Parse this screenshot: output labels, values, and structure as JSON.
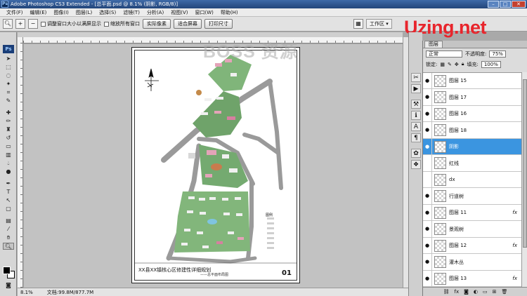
{
  "app": {
    "title": "Adobe Photoshop CS3 Extended - [总平面.psd @ 8.1% (阴影, RGB/8)]",
    "badge": "Ps"
  },
  "menu": [
    "文件(F)",
    "编辑(E)",
    "图像(I)",
    "图层(L)",
    "选择(S)",
    "滤镜(T)",
    "分析(A)",
    "视图(V)",
    "窗口(W)",
    "帮助(H)"
  ],
  "options": {
    "check_resize": "调整窗口大小以满屏显示",
    "check_zoom_all": "缩放所有窗口",
    "btn_actual": "实际像素",
    "btn_fit": "适合屏幕",
    "btn_print": "打印尺寸",
    "workspace": "工作区 ▾"
  },
  "watermark": "BOSS 资源",
  "logo": "Uzing.net",
  "plan": {
    "title": "XX县XX镇核心区修建性详细规划",
    "subtitle": "——总平面布局图",
    "number": "01",
    "legend_title": "图例"
  },
  "status": {
    "zoom": "8.1%",
    "doc": "文档:99.8M/877.7M"
  },
  "layers_panel": {
    "tab": "图层",
    "blend": "正常",
    "opacity_label": "不透明度:",
    "opacity": "75%",
    "lock_label": "锁定:",
    "fill_label": "填充:",
    "fill": "100%",
    "layers": [
      {
        "name": "图层 15",
        "visible": true,
        "fx": false,
        "selected": false
      },
      {
        "name": "图层 17",
        "visible": true,
        "fx": false,
        "selected": false
      },
      {
        "name": "图层 16",
        "visible": true,
        "fx": false,
        "selected": false
      },
      {
        "name": "图层 18",
        "visible": true,
        "fx": false,
        "selected": false
      },
      {
        "name": "阴影",
        "visible": true,
        "fx": false,
        "selected": true
      },
      {
        "name": "红线",
        "visible": false,
        "fx": false,
        "selected": false
      },
      {
        "name": "dx",
        "visible": false,
        "fx": false,
        "selected": false
      },
      {
        "name": "行道树",
        "visible": true,
        "fx": false,
        "selected": false
      },
      {
        "name": "图层 11",
        "visible": true,
        "fx": true,
        "selected": false
      },
      {
        "name": "景观树",
        "visible": true,
        "fx": false,
        "selected": false
      },
      {
        "name": "图层 12",
        "visible": true,
        "fx": true,
        "selected": false
      },
      {
        "name": "灌木丛",
        "visible": true,
        "fx": false,
        "selected": false
      },
      {
        "name": "图层 13",
        "visible": true,
        "fx": true,
        "selected": false
      }
    ],
    "fx_label": "fx",
    "eye_glyph": "●"
  },
  "colors": {
    "selection": "#3b95e0",
    "logo_red": "#e8252c"
  }
}
